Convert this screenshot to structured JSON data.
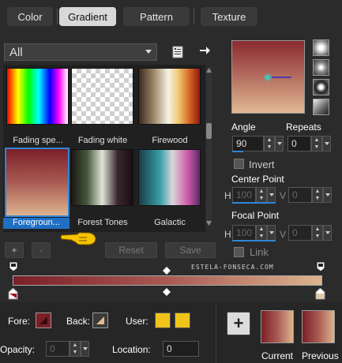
{
  "tabs": [
    {
      "label": "Color",
      "active": false
    },
    {
      "label": "Gradient",
      "active": true
    },
    {
      "label": "Pattern",
      "active": false
    },
    {
      "label": "Texture",
      "active": false
    }
  ],
  "category": {
    "value": "All"
  },
  "gallery": {
    "items": [
      {
        "label": "Fading spe...",
        "selected": false
      },
      {
        "label": "Fading white",
        "selected": false
      },
      {
        "label": "Firewood",
        "selected": false
      },
      {
        "label": "Foregroun...",
        "selected": true
      },
      {
        "label": "Forest Tones",
        "selected": false
      },
      {
        "label": "Galactic",
        "selected": false
      }
    ]
  },
  "gallery_buttons": {
    "add": "+",
    "remove": "-",
    "reset": "Reset",
    "save": "Save"
  },
  "angle": {
    "label": "Angle",
    "value": "90"
  },
  "repeats": {
    "label": "Repeats",
    "value": "0"
  },
  "invert": {
    "label": "Invert",
    "checked": false
  },
  "center_point": {
    "label": "Center Point",
    "h_label": "H",
    "h_value": "100",
    "v_label": "V",
    "v_value": "0"
  },
  "focal_point": {
    "label": "Focal Point",
    "h_label": "H",
    "h_value": "100",
    "v_label": "V",
    "v_value": "0"
  },
  "link": {
    "label": "Link",
    "checked": false
  },
  "watermark": "ESTELA-FONSECA.COM",
  "gradient": {
    "start_color": "#7a1f28",
    "end_color": "#dcb48e"
  },
  "bottom": {
    "fore_label": "Fore:",
    "back_label": "Back:",
    "user_label": "User:",
    "user_colors": [
      "#f0c41a",
      "#f0c41a"
    ],
    "opacity_label": "Opacity:",
    "opacity_value": "0",
    "location_label": "Location:",
    "location_value": "0",
    "current_label": "Current",
    "previous_label": "Previous"
  }
}
